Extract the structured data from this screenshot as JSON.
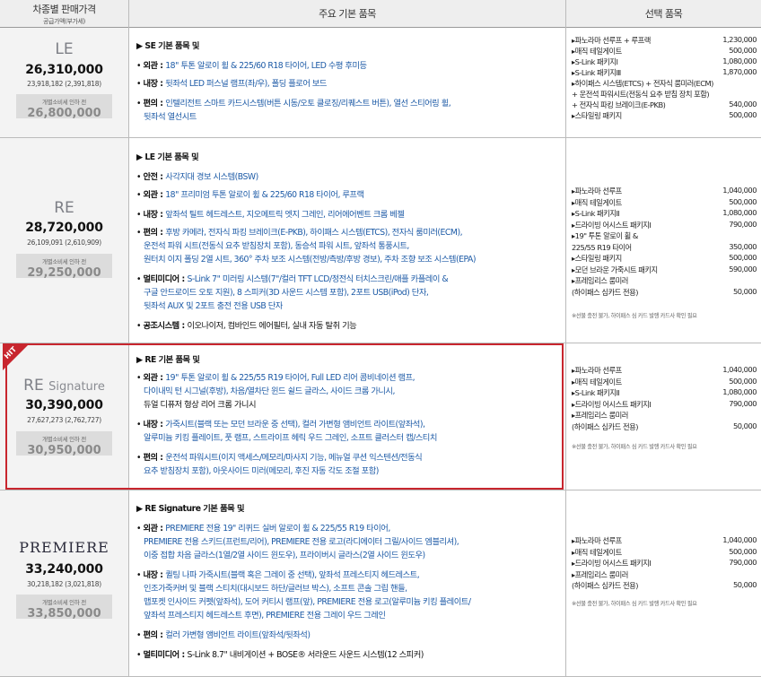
{
  "header": {
    "col1_title": "차종별 판매가격",
    "col1_sub": "공급가액(부가세)",
    "col2_title": "주요 기본 품목",
    "col3_title": "선택 품목"
  },
  "trims": [
    {
      "name": "LE",
      "name_sub": "",
      "price": "26,310,000",
      "price_sub": "23,918,182 (2,391,818)",
      "pre_label": "개별소비세 인하 전",
      "pre_price": "26,800,000",
      "features": [
        {
          "head": "▶ SE 기본 품목 및"
        },
        {
          "cat": "외관",
          "text": "18\" 투톤 알로이 휠 & 225/60 R18 타이어, LED 수평 후미등"
        },
        {
          "cat": "내장",
          "text": "뒷좌석 LED 퍼스널 램프(좌/우), 폴딩 플로어 보드"
        },
        {
          "cat": "편의",
          "text": "인텔리전트 스마트 카드시스템(버튼 시동/오토 클로징/리퀘스트 버튼), 열선 스티어링 휠,"
        },
        {
          "cont": "뒷좌석 열선시트"
        }
      ],
      "options": [
        {
          "label": "▸파노라마 선루프 + 루프랙",
          "value": "1,230,000"
        },
        {
          "label": "▸매직 테일게이트",
          "value": "500,000"
        },
        {
          "label": "▸S-Link 패키지Ⅰ",
          "value": "1,080,000"
        },
        {
          "label": "▸S-Link 패키지Ⅲ",
          "value": "1,870,000"
        },
        {
          "label": "▸하이패스 시스템(ETCS) + 전자식 룸미러(ECM)",
          "value": ""
        },
        {
          "label": "  + 운전석 파워시트(전동식 요추 받침 장치 포함)",
          "value": ""
        },
        {
          "label": "  + 전자식 파킹 브레이크(E-PKB)",
          "value": "540,000"
        },
        {
          "label": "▸스타일링 패키지",
          "value": "500,000"
        }
      ],
      "note": ""
    },
    {
      "name": "RE",
      "name_sub": "",
      "price": "28,720,000",
      "price_sub": "26,109,091 (2,610,909)",
      "pre_label": "개별소비세 인하 전",
      "pre_price": "29,250,000",
      "features": [
        {
          "head": "▶ LE 기본 품목 및"
        },
        {
          "cat": "안전",
          "text": "사각지대 경보 시스템(BSW)"
        },
        {
          "cat": "외관",
          "text": "18\" 프리미엄 투톤 알로이 휠 & 225/60 R18 타이어, 루프랙"
        },
        {
          "cat": "내장",
          "text": "앞좌석 틸트 헤드레스트, 지오메트릭 엣지 그레인, 리어에어벤트 크롬 베젤"
        },
        {
          "cat": "편의",
          "text": "후방 카메라, 전자식 파킹 브레이크(E-PKB), 하이패스 시스템(ETCS), 전자식 룸미러(ECM),"
        },
        {
          "cont": "운전석 파워 시트(전동식 요추 받침장치 포함), 동승석 파워 시트, 앞좌석 통풍시트,"
        },
        {
          "cont": "원터치 이지 폴딩 2열 시트, 360° 주차 보조 시스템(전방/측방/후방 경보), 주차 조향 보조 시스템(EPA)"
        },
        {
          "cat": "멀티미디어",
          "text": "S-Link 7\" 미러링 시스템(7\"/컬러 TFT LCD/정전식 터치스크린/애플 카플레이 &"
        },
        {
          "cont": "구글 안드로이드 오토 지원), 8 스피커(3D 사운드 시스템 포함), 2포트 USB(iPod) 단자,"
        },
        {
          "cont": "뒷좌석 AUX 및 2포트 충전 전용 USB 단자"
        },
        {
          "cat": "공조시스템",
          "text": "이오나이저, 컴바인드 에어필터, 실내 자동 탈취 기능",
          "dark": true
        }
      ],
      "options": [
        {
          "label": "▸파노라마 선루프",
          "value": "1,040,000"
        },
        {
          "label": "▸매직 테일게이트",
          "value": "500,000"
        },
        {
          "label": "▸S-Link 패키지Ⅱ",
          "value": "1,080,000"
        },
        {
          "label": "▸드라이빙 어시스트 패키지Ⅰ",
          "value": "790,000"
        },
        {
          "label": "▸19\" 투톤 알로이 휠 &",
          "value": ""
        },
        {
          "label": "  225/55 R19 타이어",
          "value": "350,000"
        },
        {
          "label": "▸스타일링 패키지",
          "value": "500,000"
        },
        {
          "label": "▸모던 브라운 가죽시트 패키지",
          "value": "590,000"
        },
        {
          "label": "▸프레임리스 룸미러",
          "value": ""
        },
        {
          "label": "  (하이패스 심카드 전용)",
          "value": "50,000"
        }
      ],
      "note": "※선불 충전 불가, 하이패스 심 카드 발행 카드사 확인 필요"
    },
    {
      "name": "RE",
      "name_sub": "Signature",
      "price": "30,390,000",
      "price_sub": "27,627,273 (2,762,727)",
      "pre_label": "개별소비세 인하 전",
      "pre_price": "30,950,000",
      "hit": "HIT",
      "features": [
        {
          "head": "▶ RE 기본 품목 및"
        },
        {
          "cat": "외관",
          "text": "19\" 투톤 알로이 휠 & 225/55 R19 타이어, Full LED 리어 콤비네이션 램프,"
        },
        {
          "cont": "다이내믹 턴 시그널(후방), 차음/열차단 윈드 쉴드 글라스, 사이드 크롬 가니시,"
        },
        {
          "cont": "듀얼 디퓨저 형상 리어 크롬 가니시",
          "dark": true
        },
        {
          "cat": "내장",
          "text": "가죽시트(블랙 또는 모던 브라운 중 선택), 컬러 가변형 앰비언트 라이트(앞좌석),"
        },
        {
          "cont": "알루미늄 키킹 플레이트, 풋 램프, 스트라이프 헤릭 우드 그레인, 소프트 클러스터 캡/스티치"
        },
        {
          "cat": "편의",
          "text": "운전석 파워시트(이지 액세스/메모리/마사지 기능, 메뉴얼 쿠션 익스텐션/전동식"
        },
        {
          "cont": "요추 받침장치 포함), 아웃사이드 미러(메모리, 후진 자동 각도 조절 포함)"
        }
      ],
      "options": [
        {
          "label": "▸파노라마 선루프",
          "value": "1,040,000"
        },
        {
          "label": "▸매직 테일게이트",
          "value": "500,000"
        },
        {
          "label": "▸S-Link 패키지Ⅱ",
          "value": "1,080,000"
        },
        {
          "label": "▸드라이빙 어시스트 패키지Ⅰ",
          "value": "790,000"
        },
        {
          "label": "▸프레임리스 룸미러",
          "value": ""
        },
        {
          "label": "  (하이패스 심카드 전용)",
          "value": "50,000"
        }
      ],
      "note": "※선불 충전 불가, 하이패스 심 카드 발행 카드사 확인 필요"
    },
    {
      "name": "PREMIERE",
      "name_sub": "",
      "price": "33,240,000",
      "price_sub": "30,218,182 (3,021,818)",
      "pre_label": "개별소비세 인하 전",
      "pre_price": "33,850,000",
      "features": [
        {
          "head": "▶ RE Signature 기본 품목 및"
        },
        {
          "cat": "외관",
          "text": "PREMIERE 전용 19\" 리퀴드 실버 알로이 휠 & 225/55 R19 타이어,"
        },
        {
          "cont": "PREMIERE 전용 스키드(프런트/리어), PREMIERE 전용 로고(라디에이터 그릴/사이드 엠블리셔),"
        },
        {
          "cont": "이중 접합 차음 글라스(1열/2열 사이드 윈도우), 프라이버시 글라스(2열 사이드 윈도우)"
        },
        {
          "cat": "내장",
          "text": "퀼팅 나파 가죽시트(블랙 혹은 그레이 중 선택), 앞좌석 프레스티지 헤드레스트,"
        },
        {
          "cont": "인조가죽커버 및 블랙 스티치(대시보드 하단/글러브 박스), 소프트 콘솔 그립 핸들,"
        },
        {
          "cont": "맵포켓 인사이드 커펫(앞좌석), 도어 커티시 램프(앞), PREMIERE 전용 로고(알루미늄 키킹 플레이트/"
        },
        {
          "cont": "앞좌석 프레스티지 헤드레스트 후면), PREMIERE 전용 그레이 우드 그레인"
        },
        {
          "cat": "편의",
          "text": "컬러 가변형 앰비언트 라이트(앞좌석/뒷좌석)"
        },
        {
          "cat": "멀티미디어",
          "text": "S-Link 8.7\" 내비게이션 + BOSE® 서라운드 사운드 시스템(12 스피커)",
          "dark": true
        }
      ],
      "options": [
        {
          "label": "▸파노라마 선루프",
          "value": "1,040,000"
        },
        {
          "label": "▸매직 테일게이트",
          "value": "500,000"
        },
        {
          "label": "▸드라이빙 어시스트 패키지Ⅰ",
          "value": "790,000"
        },
        {
          "label": "▸프레임리스 룸미러",
          "value": ""
        },
        {
          "label": "  (하이패스 심카드 전용)",
          "value": "50,000"
        }
      ],
      "note": "※선불 충전 불가, 하이패스 심 카드 발행 카드사 확인 필요"
    }
  ]
}
